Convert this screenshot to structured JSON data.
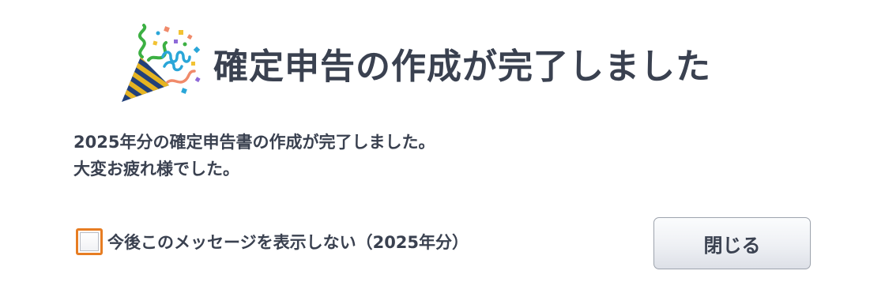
{
  "dialog": {
    "icon": "party-popper-icon",
    "title": "確定申告の作成が完了しました",
    "message": {
      "line1": "2025年分の確定申告書の作成が完了しました。",
      "line2": "大変お疲れ様でした。"
    },
    "checkbox": {
      "label": "今後このメッセージを表示しない（2025年分）",
      "checked": false
    },
    "close_label": "閉じる"
  },
  "colors": {
    "text": "#3a4150",
    "checkbox_focus": "#e77d23",
    "button_border": "#9da3ad"
  }
}
